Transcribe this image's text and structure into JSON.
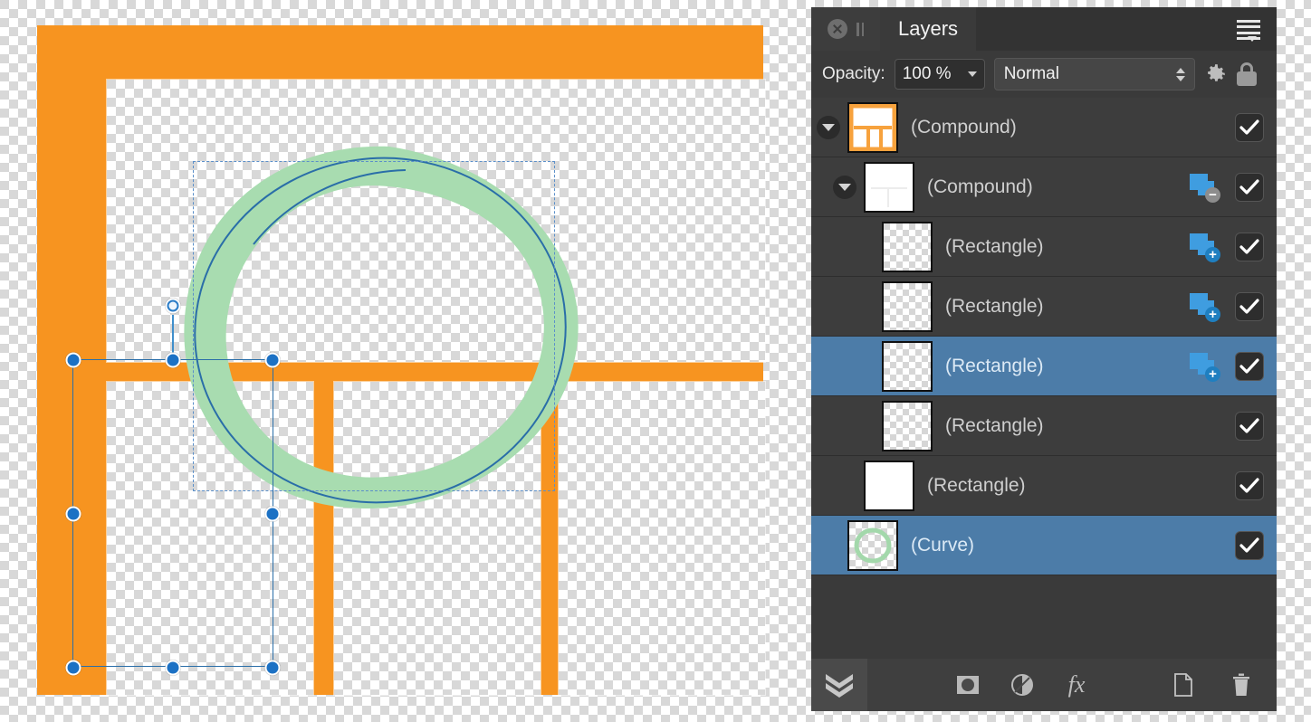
{
  "panel": {
    "tab_label": "Layers",
    "close_icon": "close-icon",
    "grip_icon": "grip-handle-icon",
    "menu_icon": "panel-menu-icon"
  },
  "opacity_row": {
    "label": "Opacity:",
    "value": "100 %",
    "blend_mode": "Normal",
    "gear_icon": "gear-icon",
    "lock_icon": "lock-icon"
  },
  "layers": [
    {
      "name": "(Compound)",
      "indent": 0,
      "has_disclosure": true,
      "thumb": "compound-orange-grid",
      "boolean_op": "",
      "visible": true,
      "selected": false
    },
    {
      "name": "(Compound)",
      "indent": 1,
      "has_disclosure": true,
      "thumb": "white-partial",
      "boolean_op": "subtract",
      "visible": true,
      "selected": false
    },
    {
      "name": "(Rectangle)",
      "indent": 2,
      "has_disclosure": false,
      "thumb": "checker",
      "boolean_op": "add",
      "visible": true,
      "selected": false
    },
    {
      "name": "(Rectangle)",
      "indent": 2,
      "has_disclosure": false,
      "thumb": "checker",
      "boolean_op": "add",
      "visible": true,
      "selected": false
    },
    {
      "name": "(Rectangle)",
      "indent": 2,
      "has_disclosure": false,
      "thumb": "checker",
      "boolean_op": "add",
      "visible": true,
      "selected": true
    },
    {
      "name": "(Rectangle)",
      "indent": 2,
      "has_disclosure": false,
      "thumb": "checker",
      "boolean_op": "",
      "visible": true,
      "selected": false
    },
    {
      "name": "(Rectangle)",
      "indent": 1,
      "has_disclosure": false,
      "thumb": "white",
      "boolean_op": "",
      "visible": true,
      "selected": false
    },
    {
      "name": "(Curve)",
      "indent": 0,
      "has_disclosure": false,
      "thumb": "green-curve",
      "boolean_op": "",
      "visible": true,
      "selected": true
    }
  ],
  "bottom_toolbar": {
    "layers_stack_icon": "layers-stack-icon",
    "mask_icon": "mask-icon",
    "adjustment_icon": "adjustment-icon",
    "fx_label": "fx",
    "new_layer_icon": "new-layer-icon",
    "delete_icon": "trash-icon"
  },
  "canvas": {
    "frame_color": "#f79420",
    "curve_color": "#a8dcb0",
    "path_color": "#2a6ea8",
    "selection_color": "#1c71c4",
    "bbox_color": "#5b8fc9"
  }
}
